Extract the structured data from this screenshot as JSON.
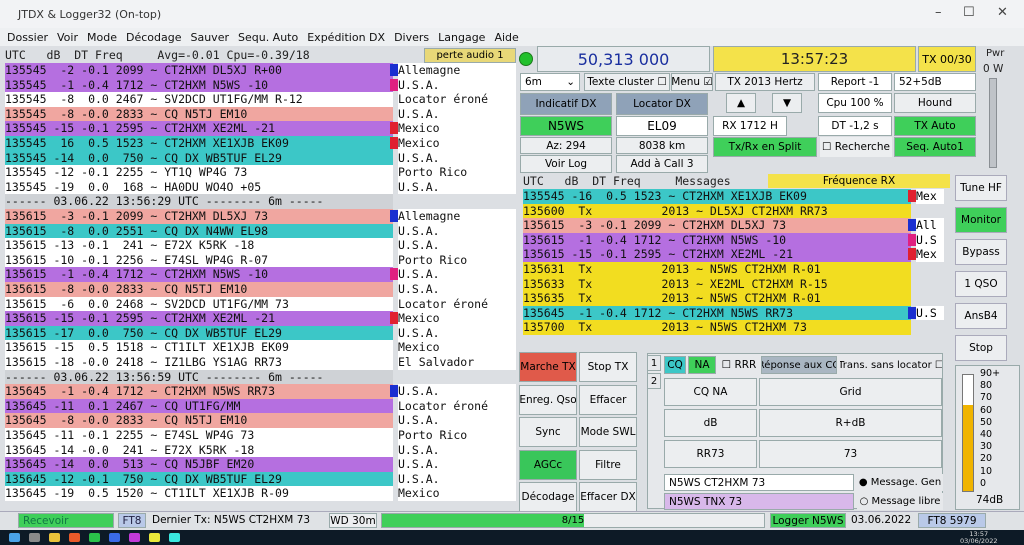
{
  "app": {
    "title": "JTDX & Logger32  (On-top)",
    "min": "–",
    "max": "☐",
    "close": "✕"
  },
  "menu": [
    "Dossier",
    "Voir",
    "Mode",
    "Décodage",
    "Sauver",
    "Sequ. Auto",
    "Expédition DX",
    "Divers",
    "Langage",
    "Aide"
  ],
  "left_header": "UTC   dB  DT Freq     Avg=-0.01 Cpu=-0.39/18",
  "audio_label": "perte audio 1",
  "left_rows": [
    {
      "t": "135545  -2 -0.1 2099 ~ CT2HXM DL5XJ R+00",
      "bg": "#b56fe0",
      "c": "Allemagne",
      "bx": "#1a2fd0"
    },
    {
      "t": "135545  -1 -0.4 1712 ~ CT2HXM N5WS -10",
      "bg": "#b56fe0",
      "c": "U.S.A.",
      "bx": "#e02080"
    },
    {
      "t": "135545  -8  0.0 2467 ~ SV2DCD UT1FG/MM R-12",
      "bg": "#ffffff",
      "c": "Locator éroné",
      "bx": ""
    },
    {
      "t": "135545  -8 -0.0 2833 ~ CQ N5TJ EM10",
      "bg": "#f0a6a0",
      "c": "U.S.A.",
      "bx": ""
    },
    {
      "t": "135545 -15 -0.1 2595 ~ CT2HXM XE2ML -21",
      "bg": "#b56fe0",
      "c": "Mexico",
      "bx": "#e02030"
    },
    {
      "t": "135545  16  0.5 1523 ~ CT2HXM XE1XJB EK09",
      "bg": "#3cc7c7",
      "c": "Mexico",
      "bx": "#e02030"
    },
    {
      "t": "135545 -14  0.0  750 ~ CQ DX WB5TUF EL29",
      "bg": "#3cc7c7",
      "c": "U.S.A.",
      "bx": ""
    },
    {
      "t": "135545 -12 -0.1 2255 ~ YT1Q WP4G 73",
      "bg": "#ffffff",
      "c": "Porto Rico",
      "bx": ""
    },
    {
      "t": "135545 -19  0.0  168 ~ HA0DU WO4O +05",
      "bg": "#ffffff",
      "c": "U.S.A.",
      "bx": ""
    },
    {
      "t": "------ 03.06.22 13:56:29 UTC -------- 6m -----",
      "bg": "#cfd2d6",
      "c": "",
      "bx": ""
    },
    {
      "t": "135615  -3 -0.1 2099 ~ CT2HXM DL5XJ 73",
      "bg": "#f0a6a0",
      "c": "Allemagne",
      "bx": "#1a2fd0"
    },
    {
      "t": "135615  -8  0.0 2551 ~ CQ DX N4WW EL98",
      "bg": "#3cc7c7",
      "c": "U.S.A.",
      "bx": ""
    },
    {
      "t": "135615 -13 -0.1  241 ~ E72X K5RK -18",
      "bg": "#ffffff",
      "c": "U.S.A.",
      "bx": ""
    },
    {
      "t": "135615 -10 -0.1 2256 ~ E74SL WP4G R-07",
      "bg": "#ffffff",
      "c": "Porto Rico",
      "bx": ""
    },
    {
      "t": "135615  -1 -0.4 1712 ~ CT2HXM N5WS -10",
      "bg": "#b56fe0",
      "c": "U.S.A.",
      "bx": "#e02080"
    },
    {
      "t": "135615  -8 -0.0 2833 ~ CQ N5TJ EM10",
      "bg": "#f0a6a0",
      "c": "U.S.A.",
      "bx": ""
    },
    {
      "t": "135615  -6  0.0 2468 ~ SV2DCD UT1FG/MM 73",
      "bg": "#ffffff",
      "c": "Locator éroné",
      "bx": ""
    },
    {
      "t": "135615 -15 -0.1 2595 ~ CT2HXM XE2ML -21",
      "bg": "#b56fe0",
      "c": "Mexico",
      "bx": "#e02030"
    },
    {
      "t": "135615 -17  0.0  750 ~ CQ DX WB5TUF EL29",
      "bg": "#3cc7c7",
      "c": "U.S.A.",
      "bx": ""
    },
    {
      "t": "135615 -15  0.5 1518 ~ CT1ILT XE1XJB EK09",
      "bg": "#ffffff",
      "c": "Mexico",
      "bx": ""
    },
    {
      "t": "135615 -18 -0.0 2418 ~ IZ1LBG YS1AG RR73",
      "bg": "#ffffff",
      "c": "El Salvador",
      "bx": ""
    },
    {
      "t": "------ 03.06.22 13:56:59 UTC -------- 6m -----",
      "bg": "#cfd2d6",
      "c": "",
      "bx": ""
    },
    {
      "t": "135645  -1 -0.4 1712 ~ CT2HXM N5WS RR73",
      "bg": "#f0a6a0",
      "c": "U.S.A.",
      "bx": "#1a2fd0"
    },
    {
      "t": "135645 -11  0.1 2467 ~ CQ UT1FG/MM",
      "bg": "#b56fe0",
      "c": "Locator éroné",
      "bx": ""
    },
    {
      "t": "135645  -8 -0.0 2833 ~ CQ N5TJ EM10",
      "bg": "#f0a6a0",
      "c": "U.S.A.",
      "bx": ""
    },
    {
      "t": "135645 -11 -0.1 2255 ~ E74SL WP4G 73",
      "bg": "#ffffff",
      "c": "Porto Rico",
      "bx": ""
    },
    {
      "t": "135645 -14 -0.0  241 ~ E72X K5RK -18",
      "bg": "#ffffff",
      "c": "U.S.A.",
      "bx": ""
    },
    {
      "t": "135645 -14  0.0  513 ~ CQ N5JBF EM20",
      "bg": "#b56fe0",
      "c": "U.S.A.",
      "bx": ""
    },
    {
      "t": "135645 -12 -0.1  750 ~ CQ DX WB5TUF EL29",
      "bg": "#3cc7c7",
      "c": "U.S.A.",
      "bx": ""
    },
    {
      "t": "135645 -19  0.5 1520 ~ CT1ILT XE1XJB R-09",
      "bg": "#ffffff",
      "c": "Mexico",
      "bx": ""
    }
  ],
  "freq": "50,313 000",
  "clock": "13:57:23",
  "tx_counter": "TX 00/30",
  "pwr_label": "Pwr",
  "pwr_value": "0 W",
  "band": "6m",
  "texte_cluster": "Texte cluster",
  "menu_chk": "Menu",
  "tx_hertz": "TX  2013  Hertz",
  "report": "Report -1",
  "s52": "52+5dB",
  "indicatif_dx": "Indicatif DX",
  "locator_dx": "Locator DX",
  "dx_call": "N5WS",
  "dx_grid": "EL09",
  "az": "Az: 294",
  "dist": "8038 km",
  "cpu": "Cpu  100 %",
  "hound": "Hound",
  "rx_freq": "RX  1712  H",
  "dt": "DT -1,2 s",
  "tx_auto": "TX Auto",
  "voir_log": "Voir Log",
  "add_call": "Add à Call 3",
  "tx_rx_split": "Tx/Rx en Split",
  "recherche": "Recherche",
  "seq_auto": "Seq. Auto1",
  "right_header": "UTC   dB  DT Freq     Messages",
  "freq_rx_label": "Fréquence RX",
  "right_rows": [
    {
      "t": "135545 -16  0.5 1523 ~ CT2HXM XE1XJB EK09",
      "bg": "#3cc7c7",
      "c": "Mex",
      "bx": "#e02030"
    },
    {
      "t": "135600  Tx          2013 ~ DL5XJ CT2HXM RR73",
      "bg": "#f2dd20",
      "c": "",
      "bx": ""
    },
    {
      "t": "135615  -3 -0.1 2099 ~ CT2HXM DL5XJ 73",
      "bg": "#f0a6a0",
      "c": "All",
      "bx": "#1a2fd0"
    },
    {
      "t": "135615  -1 -0.4 1712 ~ CT2HXM N5WS -10",
      "bg": "#b56fe0",
      "c": "U.S",
      "bx": "#e02080"
    },
    {
      "t": "135615 -15 -0.1 2595 ~ CT2HXM XE2ML -21",
      "bg": "#b56fe0",
      "c": "Mex",
      "bx": "#e02030"
    },
    {
      "t": "135631  Tx          2013 ~ N5WS CT2HXM R-01",
      "bg": "#f2dd20",
      "c": "",
      "bx": ""
    },
    {
      "t": "135633  Tx          2013 ~ XE2ML CT2HXM R-15",
      "bg": "#f2dd20",
      "c": "",
      "bx": ""
    },
    {
      "t": "135635  Tx          2013 ~ N5WS CT2HXM R-01",
      "bg": "#f2dd20",
      "c": "",
      "bx": ""
    },
    {
      "t": "135645  -1 -0.4 1712 ~ CT2HXM N5WS RR73",
      "bg": "#3cc7c7",
      "c": "U.S",
      "bx": "#1a2fd0"
    },
    {
      "t": "135700  Tx          2013 ~ N5WS CT2HXM 73",
      "bg": "#f2dd20",
      "c": "",
      "bx": ""
    }
  ],
  "side_buttons": [
    "Tune HF",
    "Monitor",
    "Bypass",
    "1 QSO",
    "AnsB4",
    "Stop"
  ],
  "bottom_buttons": [
    {
      "l": "Marche TX",
      "bg": "#e05a4a"
    },
    {
      "l": "Stop TX",
      "bg": "#eceef0"
    },
    {
      "l": "Enreg. Qso",
      "bg": "#eceef0"
    },
    {
      "l": "Effacer",
      "bg": "#eceef0"
    },
    {
      "l": "Sync",
      "bg": "#eceef0"
    },
    {
      "l": "Mode SWL",
      "bg": "#eceef0"
    },
    {
      "l": "AGCc",
      "bg": "#39c65a"
    },
    {
      "l": "Filtre",
      "bg": "#eceef0"
    },
    {
      "l": "Décodage",
      "bg": "#eceef0"
    },
    {
      "l": "Effacer DX",
      "bg": "#eceef0"
    }
  ],
  "cq": "CQ",
  "na": "NA",
  "rrr": "RRR",
  "reponse_cq": "Réponse aux CQ",
  "trans_sans_locator": "Trans. sans locator",
  "macros": [
    "CQ NA",
    "Grid",
    "dB",
    "R+dB",
    "RR73",
    "73"
  ],
  "tab1": "1",
  "tab2": "2",
  "msg_gen": "N5WS CT2HXM 73",
  "msg_gen_label": "Message. Gen",
  "msg_libre": "N5WS TNX 73",
  "msg_libre_label": "Message libre",
  "meter_labels": [
    "90+",
    "80",
    "70",
    "60",
    "50",
    "40",
    "30",
    "20",
    "10",
    "0"
  ],
  "meter_db": "74dB",
  "status": {
    "recevoir": "Recevoir",
    "mode": "FT8",
    "last_tx": "Dernier Tx: N5WS CT2HXM 73",
    "wd": "WD 30m",
    "progress": "8/15",
    "progress_frac": 0.53,
    "logger": "Logger N5WS",
    "date": "03.06.2022",
    "ft8_count": "FT8  5979"
  },
  "tray": {
    "time": "13:57",
    "date": "03/06/2022"
  }
}
